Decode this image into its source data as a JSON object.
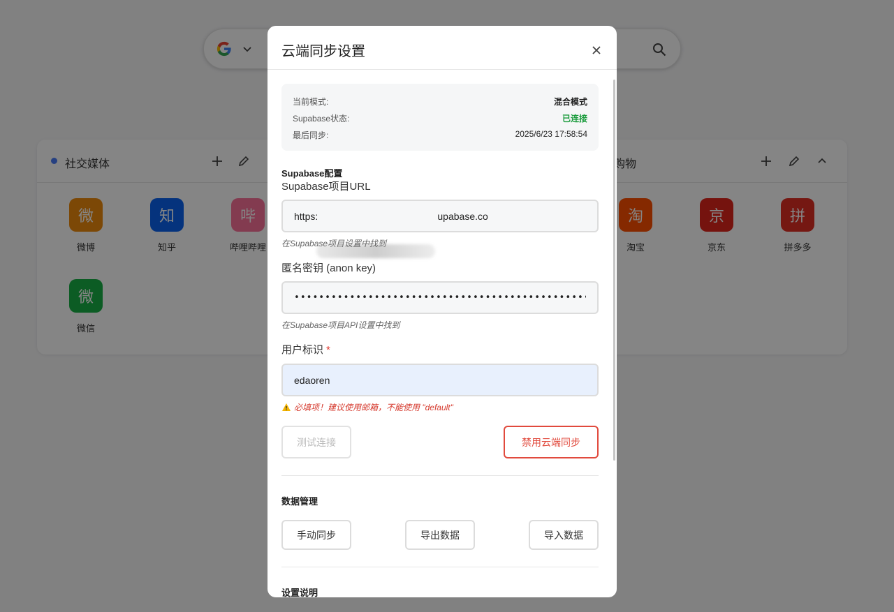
{
  "background": {
    "search": {
      "engine_letter": "G"
    },
    "left_card": {
      "title": "社交媒体",
      "sites": [
        {
          "label": "微博",
          "icon": "微",
          "color": "#ee8a0d"
        },
        {
          "label": "知乎",
          "icon": "知",
          "color": "#0a63f0"
        },
        {
          "label": "哔哩哔哩",
          "icon": "哔",
          "color": "#fb7299"
        },
        {
          "label": "微信",
          "icon": "微",
          "color": "#17b046"
        }
      ]
    },
    "right_card": {
      "title": "购物",
      "sites": [
        {
          "label": "淘宝",
          "icon": "淘",
          "color": "#ff5000"
        },
        {
          "label": "京东",
          "icon": "京",
          "color": "#e1251b"
        },
        {
          "label": "拼多多",
          "icon": "拼",
          "color": "#e02e24"
        }
      ]
    }
  },
  "modal": {
    "title": "云端同步设置",
    "status": {
      "mode_label": "当前模式:",
      "mode_value": "混合模式",
      "supabase_label": "Supabase状态:",
      "supabase_value": "已连接",
      "last_sync_label": "最后同步:",
      "last_sync_value": "2025/6/23 17:58:54"
    },
    "config": {
      "section_title": "Supabase配置",
      "url_label": "Supabase项目URL",
      "url_value": "https:                                            upabase.co",
      "url_hint": "在Supabase项目设置中找到",
      "key_label": "匿名密钥 (anon key)",
      "key_value": "•••••••••••••••••••••••••••••••••••••••••••••••••••••••••••••••••••••••••",
      "key_hint": "在Supabase项目API设置中找到",
      "user_label": "用户标识",
      "user_required": "*",
      "user_value": "edaoren",
      "user_warning": "必填项！建议使用邮箱，不能使用 \"default\"",
      "test_button": "测试连接",
      "disable_button": "禁用云端同步"
    },
    "data_management": {
      "section_title": "数据管理",
      "manual_sync": "手动同步",
      "export": "导出数据",
      "import": "导入数据"
    },
    "instructions": {
      "section_title": "设置说明"
    }
  }
}
